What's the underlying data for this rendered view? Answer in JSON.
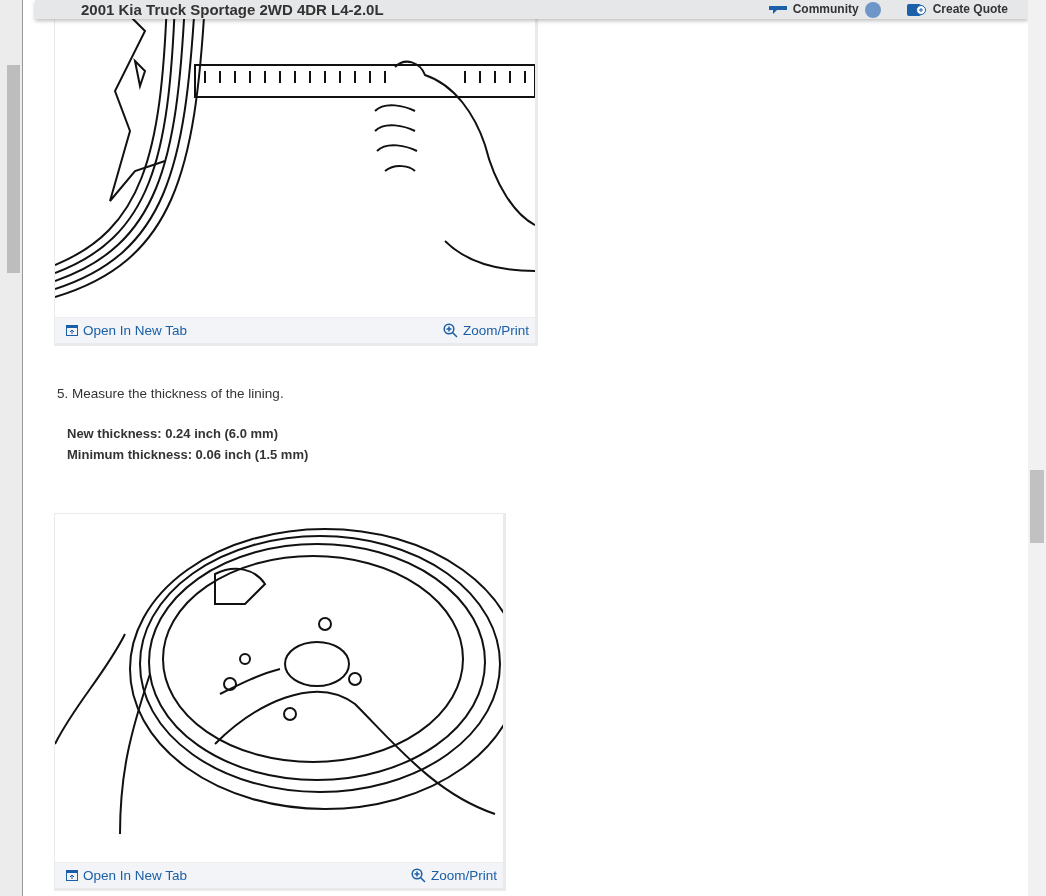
{
  "header": {
    "title": "2001 Kia Truck Sportage 2WD 4DR L4-2.0L",
    "community": "Community",
    "create_quote": "Create Quote"
  },
  "figures_top": {
    "open_link": "Open In New Tab",
    "zoom_link": "Zoom/Print"
  },
  "step": {
    "text": "5. Measure the thickness of the lining.",
    "specs": [
      "New thickness: 0.24 inch (6.0 mm)",
      "Minimum thickness: 0.06 inch (1.5 mm)"
    ]
  },
  "figure_bottom": {
    "open_link": "Open In New Tab",
    "zoom_link": "Zoom/Print"
  }
}
